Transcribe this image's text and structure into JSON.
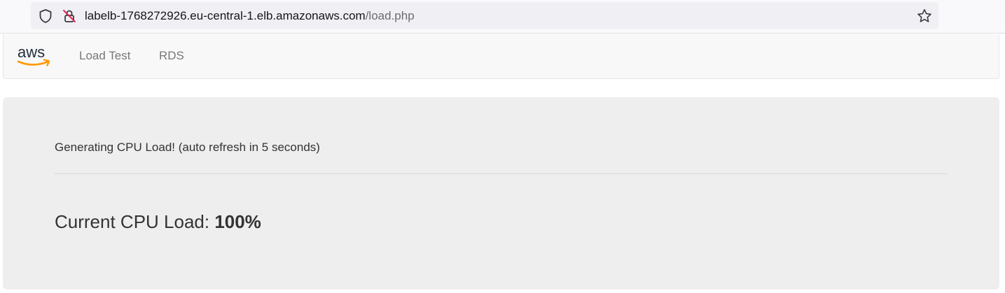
{
  "browser": {
    "url_host": "labelb-1768272926.eu-central-1.elb.amazonaws.com",
    "url_path": "/load.php",
    "icons": [
      "shield-icon",
      "lock-slash-icon",
      "star-icon"
    ]
  },
  "navbar": {
    "logo_text": "aws",
    "links": [
      {
        "label": "Load Test"
      },
      {
        "label": "RDS"
      }
    ]
  },
  "main": {
    "status_text": "Generating CPU Load! (auto refresh in 5 seconds)",
    "cpu_label": "Current CPU Load: ",
    "cpu_value": "100%"
  },
  "colors": {
    "logo_arrow": "#ff9900",
    "navbar_bg": "#f8f8f8",
    "jumbotron_bg": "#eeeeee"
  }
}
